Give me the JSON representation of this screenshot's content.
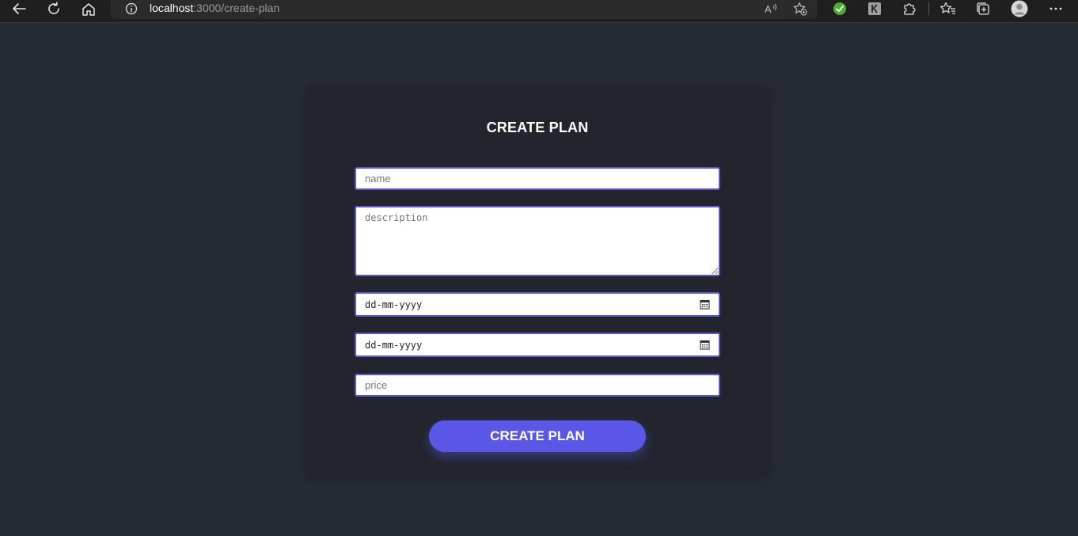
{
  "browser": {
    "url_host": "localhost",
    "url_path": ":3000/create-plan",
    "icons": {
      "back": "back-arrow-icon",
      "refresh": "refresh-icon",
      "home": "home-icon",
      "site_info": "info-icon",
      "read_aloud": "read-aloud-icon",
      "add_favorite": "add-favorite-icon",
      "extension_green": "grammar-extension-icon",
      "extension_gray": "k-extension-icon",
      "extensions": "puzzle-icon",
      "favorites": "favorites-icon",
      "collections": "collections-icon",
      "profile": "profile-icon",
      "more": "more-icon"
    }
  },
  "form": {
    "title": "CREATE PLAN",
    "name_placeholder": "name",
    "description_placeholder": "description",
    "start_date_placeholder": "dd-mm-yyyy",
    "end_date_placeholder": "dd-mm-yyyy",
    "price_placeholder": "price",
    "submit_label": "CREATE PLAN"
  },
  "colors": {
    "page_background": "#262a33",
    "card_background": "#22252d",
    "accent": "#5b57e6",
    "field_border": "#5b57d1"
  }
}
